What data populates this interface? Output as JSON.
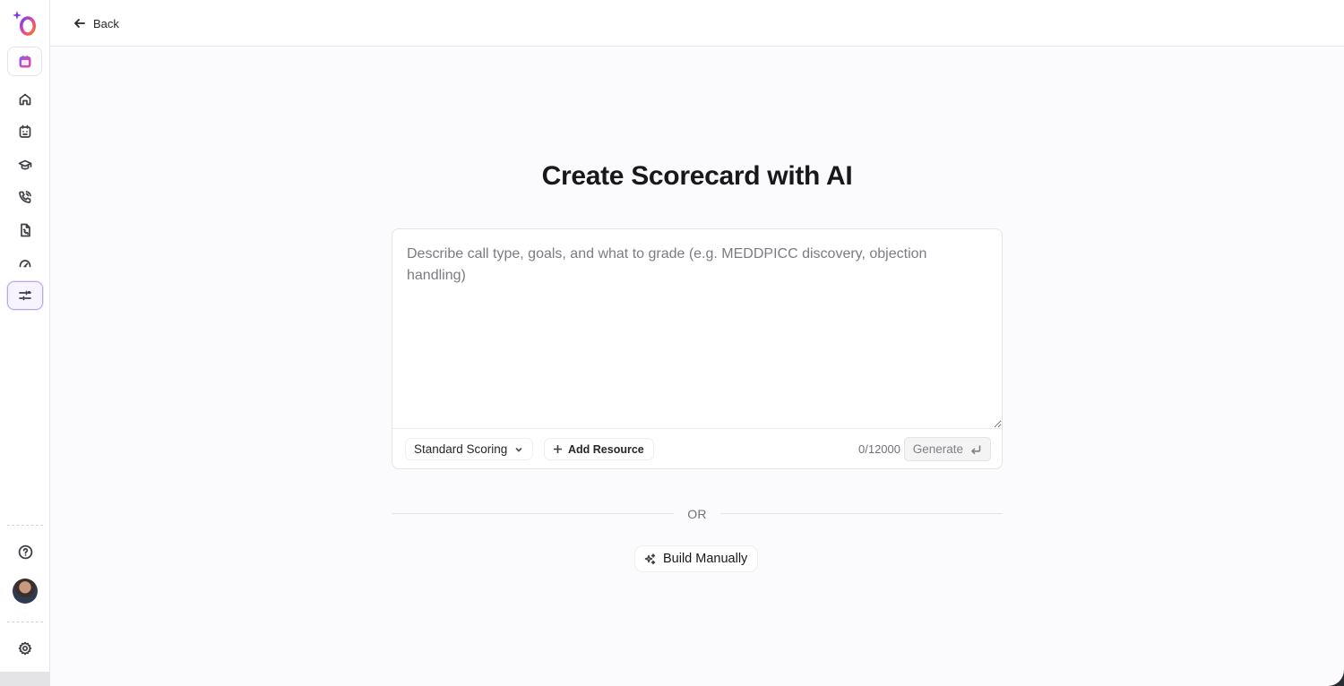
{
  "header": {
    "back_label": "Back"
  },
  "main": {
    "title": "Create Scorecard with AI",
    "prompt": {
      "placeholder": "Describe call type, goals, and what to grade (e.g. MEDDPICC discovery, objection handling)",
      "value": ""
    },
    "scoring_select": {
      "selected": "Standard Scoring"
    },
    "add_resource_label": "Add Resource",
    "char_counter": "0/12000",
    "generate_label": "Generate",
    "or_label": "OR",
    "build_manually_label": "Build Manually"
  },
  "sidebar": {
    "items": [
      {
        "icon": "home-icon"
      },
      {
        "icon": "calendar-icon"
      },
      {
        "icon": "graduation-cap-icon"
      },
      {
        "icon": "phone-call-icon"
      },
      {
        "icon": "phone-document-icon"
      },
      {
        "icon": "gauge-icon"
      },
      {
        "icon": "sliders-icon",
        "active": true
      }
    ],
    "footer": [
      {
        "icon": "help-icon"
      },
      {
        "icon": "avatar"
      },
      {
        "icon": "gear-icon"
      }
    ]
  },
  "colors": {
    "accent_border": "#b9a6ef",
    "page_background": "#fbfafc",
    "brand_gradient": [
      "#6d3cf0",
      "#ec4899",
      "#f97316"
    ]
  }
}
